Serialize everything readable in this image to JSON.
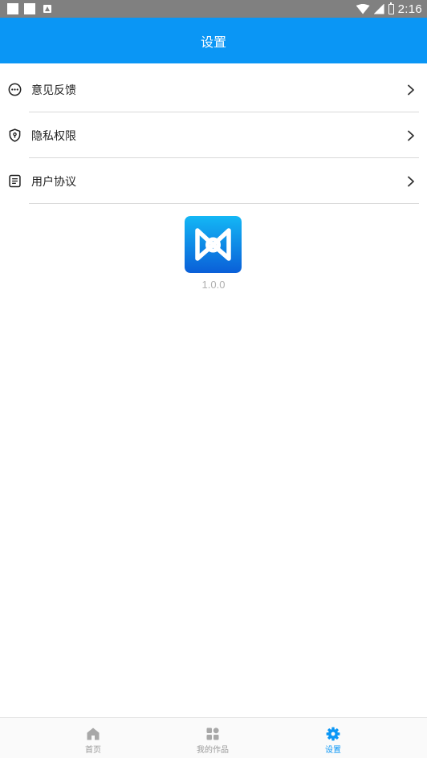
{
  "status_bar": {
    "time": "2:16"
  },
  "app_bar": {
    "title": "设置"
  },
  "menu": {
    "items": [
      {
        "label": "意见反馈",
        "icon": "chat-bubble-icon"
      },
      {
        "label": "隐私权限",
        "icon": "shield-lock-icon"
      },
      {
        "label": "用户协议",
        "icon": "document-icon"
      }
    ]
  },
  "about": {
    "version": "1.0.0"
  },
  "bottom_nav": {
    "tabs": [
      {
        "label": "首页",
        "icon": "home-icon",
        "active": false
      },
      {
        "label": "我的作品",
        "icon": "grid-icon",
        "active": false
      },
      {
        "label": "设置",
        "icon": "gear-icon",
        "active": true
      }
    ]
  },
  "colors": {
    "accent": "#0a96f5",
    "status_bar": "#808080",
    "inactive": "#9a9a9a"
  }
}
